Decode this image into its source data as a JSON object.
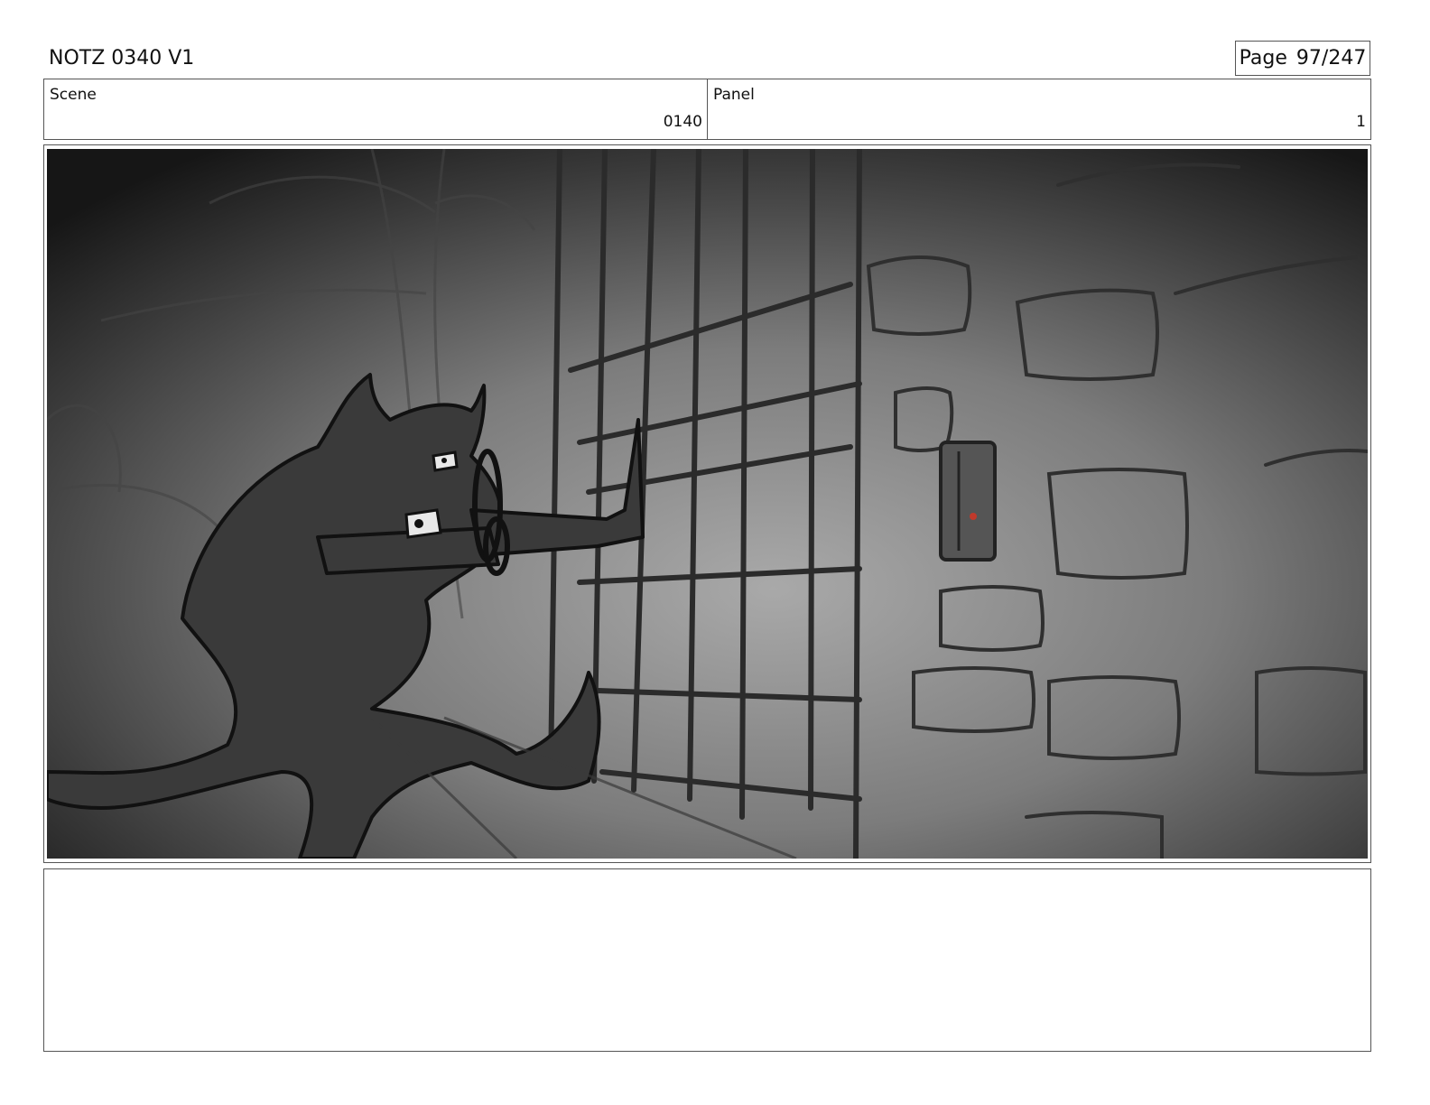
{
  "header": {
    "title": "NOTZ 0340 V1",
    "page_label": "Page",
    "page_number": "97/247"
  },
  "info": {
    "scene_label": "Scene",
    "scene_value": "0140",
    "panel_label": "Panel",
    "panel_value": "1"
  },
  "frame": {
    "description_icon": "storyboard-sketch"
  },
  "notes": {
    "text": ""
  }
}
